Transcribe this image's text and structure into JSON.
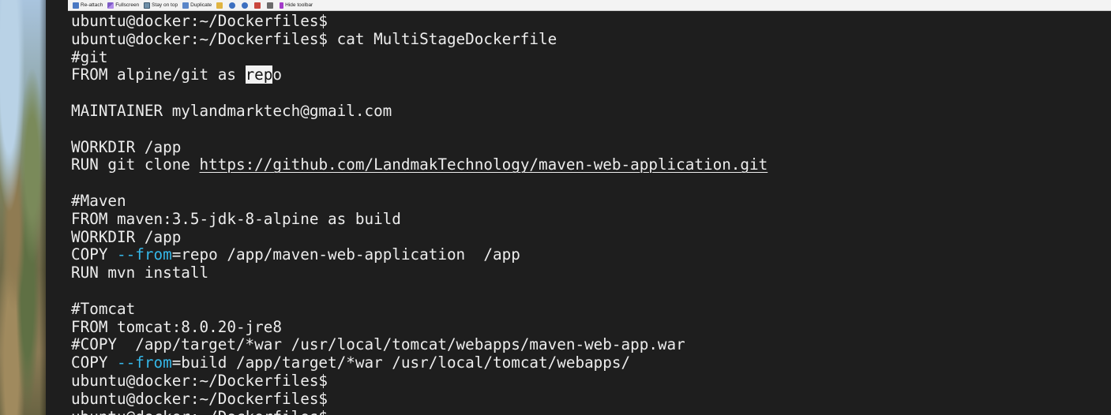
{
  "toolbar": {
    "items": [
      {
        "label": "Re-attach",
        "icon": "reattach-icon"
      },
      {
        "label": "Fullscreen",
        "icon": "fullscreen-icon"
      },
      {
        "label": "Stay on top",
        "icon": "stay-on-top-icon"
      },
      {
        "label": "Duplicate",
        "icon": "duplicate-icon"
      },
      {
        "label": "",
        "icon": "edit-icon"
      },
      {
        "label": "",
        "icon": "zoom-in-icon"
      },
      {
        "label": "",
        "icon": "zoom-out-icon"
      },
      {
        "label": "",
        "icon": "save-icon"
      },
      {
        "label": "",
        "icon": "print-icon"
      },
      {
        "label": "Hide toolbar",
        "icon": "hide-toolbar-icon"
      }
    ]
  },
  "terminal": {
    "colors": {
      "background": "#1e1e1e",
      "text": "#ededed",
      "flag": "#35b7e8",
      "selection": "#f2f2f2"
    },
    "lines": [
      {
        "segments": [
          {
            "text": "ubuntu@docker:~/Dockerfiles$"
          }
        ]
      },
      {
        "segments": [
          {
            "text": "ubuntu@docker:~/Dockerfiles$ cat MultiStageDockerfile"
          }
        ]
      },
      {
        "segments": [
          {
            "text": "#git"
          }
        ]
      },
      {
        "segments": [
          {
            "text": "FROM alpine/git as "
          },
          {
            "text": "rep",
            "style": "selected"
          },
          {
            "text": "o"
          }
        ]
      },
      {
        "segments": [
          {
            "text": ""
          }
        ]
      },
      {
        "segments": [
          {
            "text": "MAINTAINER mylandmarktech@gmail.com"
          }
        ]
      },
      {
        "segments": [
          {
            "text": ""
          }
        ]
      },
      {
        "segments": [
          {
            "text": "WORKDIR /app"
          }
        ]
      },
      {
        "segments": [
          {
            "text": "RUN git clone "
          },
          {
            "text": "https://github.com/LandmakTechnology/maven-web-application.git",
            "style": "url"
          }
        ]
      },
      {
        "segments": [
          {
            "text": ""
          }
        ]
      },
      {
        "segments": [
          {
            "text": "#Maven"
          }
        ]
      },
      {
        "segments": [
          {
            "text": "FROM maven:3.5-jdk-8-alpine as build"
          }
        ]
      },
      {
        "segments": [
          {
            "text": "WORKDIR /app"
          }
        ]
      },
      {
        "segments": [
          {
            "text": "COPY "
          },
          {
            "text": "--from",
            "style": "flag"
          },
          {
            "text": "=repo /app/maven-web-application  /app"
          }
        ]
      },
      {
        "segments": [
          {
            "text": "RUN mvn install"
          }
        ]
      },
      {
        "segments": [
          {
            "text": ""
          }
        ]
      },
      {
        "segments": [
          {
            "text": "#Tomcat"
          }
        ]
      },
      {
        "segments": [
          {
            "text": "FROM tomcat:8.0.20-jre8"
          }
        ]
      },
      {
        "segments": [
          {
            "text": "#COPY  /app/target/*war /usr/local/tomcat/webapps/maven-web-app.war"
          }
        ]
      },
      {
        "segments": [
          {
            "text": "COPY "
          },
          {
            "text": "--from",
            "style": "flag"
          },
          {
            "text": "=build /app/target/*war /usr/local/tomcat/webapps/"
          }
        ]
      },
      {
        "segments": [
          {
            "text": "ubuntu@docker:~/Dockerfiles$"
          }
        ]
      },
      {
        "segments": [
          {
            "text": "ubuntu@docker:~/Dockerfiles$"
          }
        ]
      },
      {
        "segments": [
          {
            "text": "ubuntu@docker:~/Dockerfiles$"
          }
        ]
      }
    ]
  }
}
